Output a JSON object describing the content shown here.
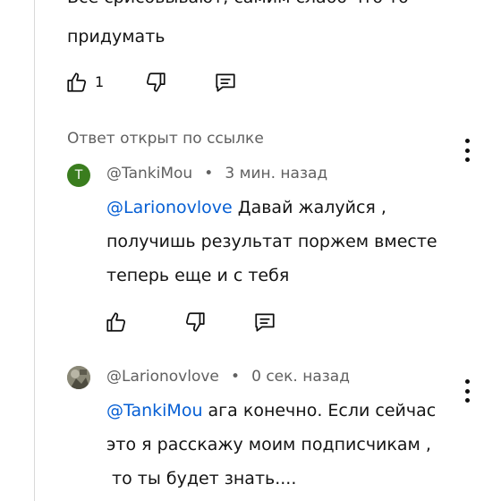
{
  "top_comment": {
    "line1": "Все срисовывают, самим слабо что то",
    "line2": "придумать",
    "like_count": "1"
  },
  "reply_notice": "Ответ открыт по ссылке",
  "reply1": {
    "avatar_letter": "T",
    "avatar_color": "#3a7d1e",
    "author": "@TankiMou",
    "separator": "•",
    "time": "3 мин. назад",
    "mention": "@Larionovlove",
    "line1": " Давай жалуйся ,",
    "line2": "получишь результат поржем вместе",
    "line3": "теперь еще и с тебя"
  },
  "reply2": {
    "author": "@Larionovlove",
    "separator": "•",
    "time": "0 сек. назад",
    "mention": "@TankiMou",
    "line1": " ага конечно. Если сейчас",
    "line2": "это я расскажу моим подписчикам ,",
    "line3": " то ты будет знать...."
  },
  "icons": {
    "like": "thumb-up-icon",
    "dislike": "thumb-down-icon",
    "reply": "comment-icon",
    "menu": "more-vertical-icon"
  }
}
